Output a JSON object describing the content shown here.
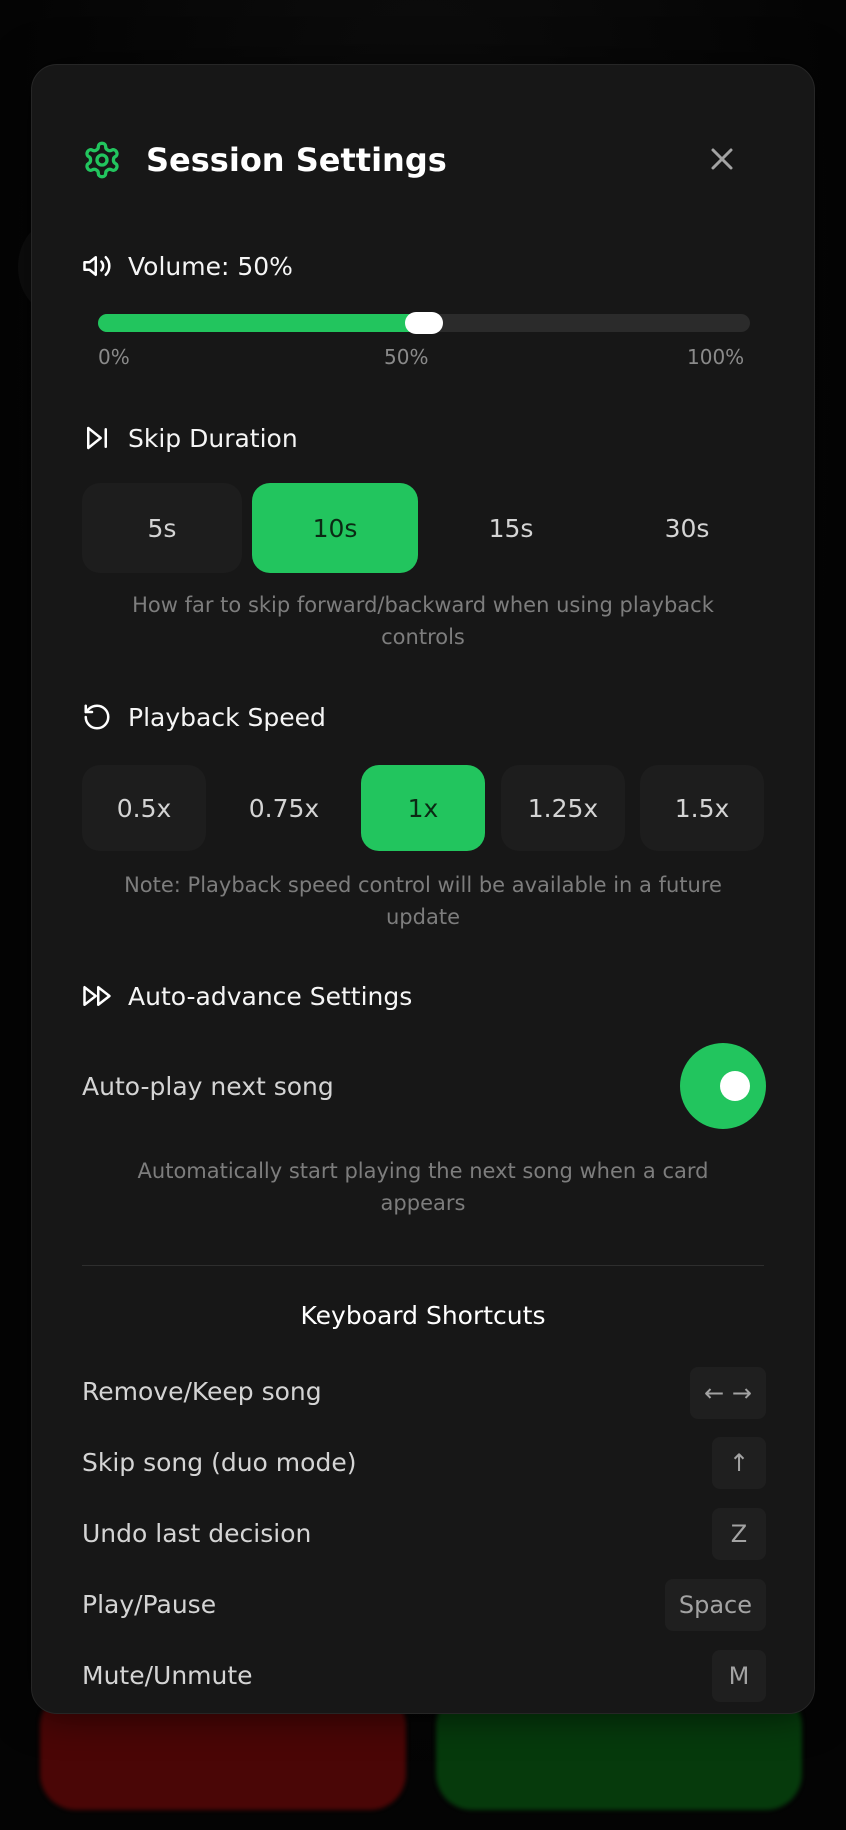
{
  "header": {
    "title": "Session Settings",
    "icon": "gear-icon",
    "close_icon": "close-icon"
  },
  "volume": {
    "label": "Volume: 50%",
    "value": 50,
    "ticks": [
      "0%",
      "50%",
      "100%"
    ]
  },
  "skip": {
    "label": "Skip Duration",
    "options": [
      "5s",
      "10s",
      "15s",
      "30s"
    ],
    "selected": "10s",
    "hint": "How far to skip forward/backward when using playback controls"
  },
  "speed": {
    "label": "Playback Speed",
    "options": [
      "0.5x",
      "0.75x",
      "1x",
      "1.25x",
      "1.5x"
    ],
    "selected": "1x",
    "hint": "Note: Playback speed control will be available in a future update"
  },
  "auto": {
    "label": "Auto-advance Settings",
    "toggle_label": "Auto-play next song",
    "enabled": true,
    "hint": "Automatically start playing the next song when a card appears"
  },
  "shortcuts": {
    "title": "Keyboard Shortcuts",
    "items": [
      {
        "label": "Remove/Keep song",
        "key": "← →"
      },
      {
        "label": "Skip song (duo mode)",
        "key": "↑"
      },
      {
        "label": "Undo last decision",
        "key": "Z"
      },
      {
        "label": "Play/Pause",
        "key": "Space"
      },
      {
        "label": "Mute/Unmute",
        "key": "M"
      }
    ]
  },
  "colors": {
    "accent": "#22c55e",
    "panel": "#171717",
    "segment": "#1d1d1d"
  }
}
